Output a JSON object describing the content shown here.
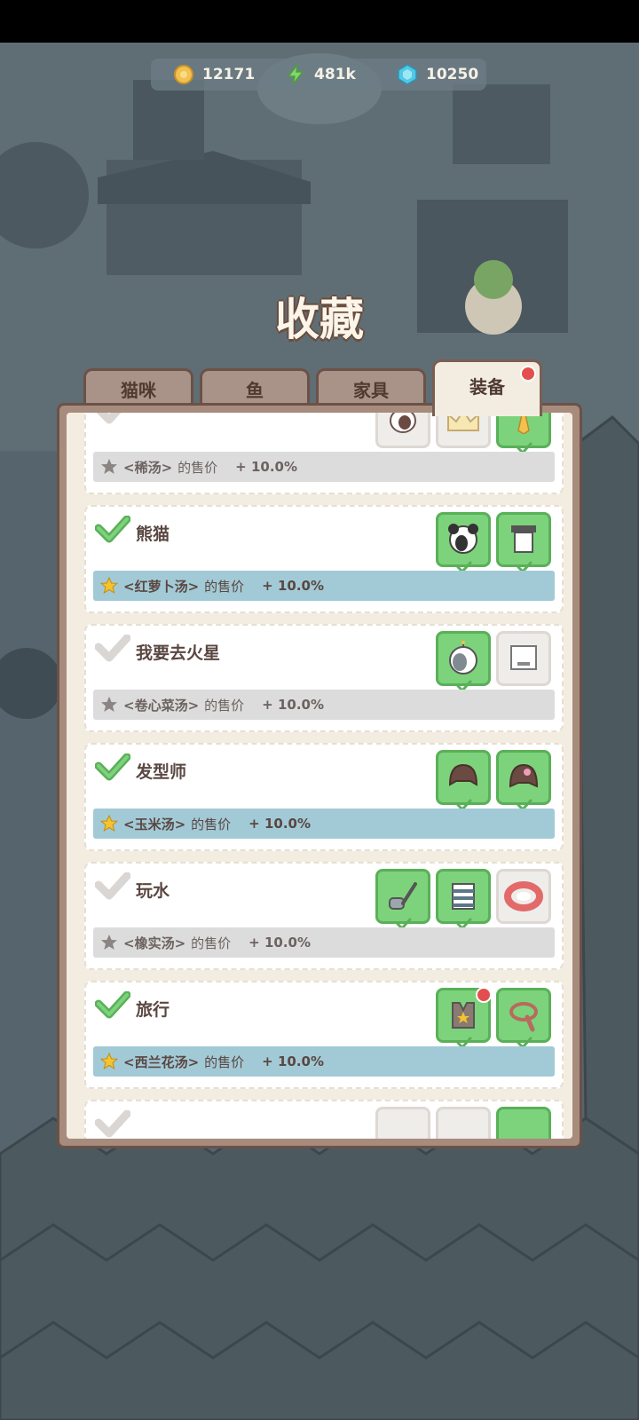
{
  "resources": [
    {
      "name": "coin-icon",
      "value": "12171"
    },
    {
      "name": "energy-icon",
      "value": "481k"
    },
    {
      "name": "gem-icon",
      "value": "10250"
    }
  ],
  "title": "收藏",
  "tabs": [
    {
      "label": "猫咪"
    },
    {
      "label": "鱼"
    },
    {
      "label": "家具"
    },
    {
      "label": "装备",
      "active": true
    }
  ],
  "collections": [
    {
      "name": "",
      "soup": "<稀汤>",
      "label": "的售价",
      "bonus": "+ 10.0%",
      "complete": false
    },
    {
      "name": "熊猫",
      "soup": "<红萝卜汤>",
      "label": "的售价",
      "bonus": "+ 10.0%",
      "complete": true
    },
    {
      "name": "我要去火星",
      "soup": "<卷心菜汤>",
      "label": "的售价",
      "bonus": "+ 10.0%",
      "complete": false
    },
    {
      "name": "发型师",
      "soup": "<玉米汤>",
      "label": "的售价",
      "bonus": "+ 10.0%",
      "complete": true
    },
    {
      "name": "玩水",
      "soup": "<橡实汤>",
      "label": "的售价",
      "bonus": "+ 10.0%",
      "complete": false
    },
    {
      "name": "旅行",
      "soup": "<西兰花汤>",
      "label": "的售价",
      "bonus": "+ 10.0%",
      "complete": true
    }
  ],
  "colors": {
    "complete": "#7dd37b",
    "bonus_on": "#a2cad6",
    "bonus_off": "#dcdcdc",
    "panel": "#a78c7e",
    "notification": "#e34f4f"
  }
}
